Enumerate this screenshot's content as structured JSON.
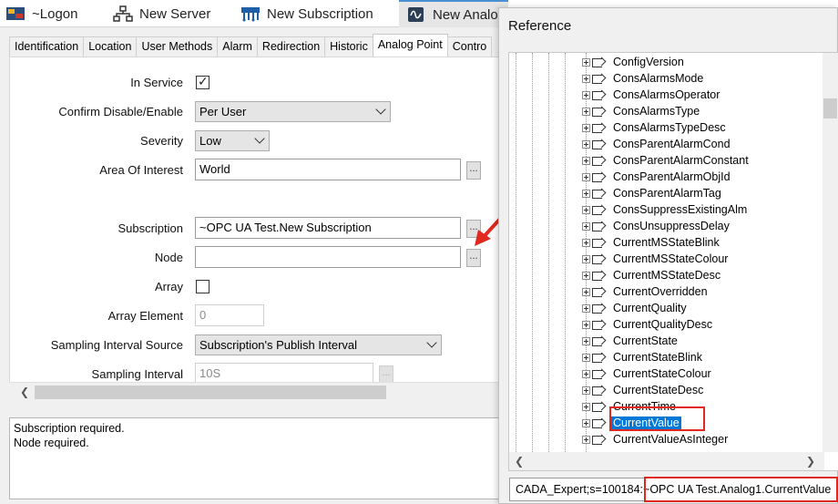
{
  "doc_tabs": [
    {
      "label": "~Logon",
      "icon": "logon-icon"
    },
    {
      "label": "New Server",
      "icon": "server-icon"
    },
    {
      "label": "New Subscription",
      "icon": "subscription-icon"
    },
    {
      "label": "New Analog",
      "icon": "analog-icon"
    }
  ],
  "prop_tabs": [
    "Identification",
    "Location",
    "User Methods",
    "Alarm",
    "Redirection",
    "Historic",
    "Analog Point",
    "Contro"
  ],
  "form": {
    "in_service": {
      "label": "In Service",
      "checked": true
    },
    "confirm": {
      "label": "Confirm Disable/Enable",
      "value": "Per User"
    },
    "severity": {
      "label": "Severity",
      "value": "Low"
    },
    "area": {
      "label": "Area Of Interest",
      "value": "World",
      "button": "..."
    },
    "subscription": {
      "label": "Subscription",
      "value": "~OPC UA Test.New Subscription",
      "button": "..."
    },
    "node": {
      "label": "Node",
      "value": "",
      "button": "..."
    },
    "array": {
      "label": "Array",
      "checked": false
    },
    "array_element": {
      "label": "Array Element",
      "value": "0"
    },
    "sampling_source": {
      "label": "Sampling Interval Source",
      "value": "Subscription's Publish Interval"
    },
    "sampling_interval": {
      "label": "Sampling Interval",
      "value": "10S",
      "button": "..."
    }
  },
  "messages": [
    "Subscription required.",
    "Node required."
  ],
  "reference": {
    "title": "Reference",
    "items": [
      "ConfigVersion",
      "ConsAlarmsMode",
      "ConsAlarmsOperator",
      "ConsAlarmsType",
      "ConsAlarmsTypeDesc",
      "ConsParentAlarmCond",
      "ConsParentAlarmConstant",
      "ConsParentAlarmObjId",
      "ConsParentAlarmTag",
      "ConsSuppressExistingAlm",
      "ConsUnsuppressDelay",
      "CurrentMSStateBlink",
      "CurrentMSStateColour",
      "CurrentMSStateDesc",
      "CurrentOverridden",
      "CurrentQuality",
      "CurrentQualityDesc",
      "CurrentState",
      "CurrentStateBlink",
      "CurrentStateColour",
      "CurrentStateDesc",
      "CurrentTime",
      "CurrentValue",
      "CurrentValueAsInteger"
    ],
    "selected": "CurrentValue",
    "path": "CADA_Expert;s=100184:~OPC UA Test.Analog1.CurrentValue"
  },
  "colors": {
    "selection": "#0078d7",
    "highlight_box": "#e0281e",
    "active_tab_accent": "#4a8fd1"
  }
}
